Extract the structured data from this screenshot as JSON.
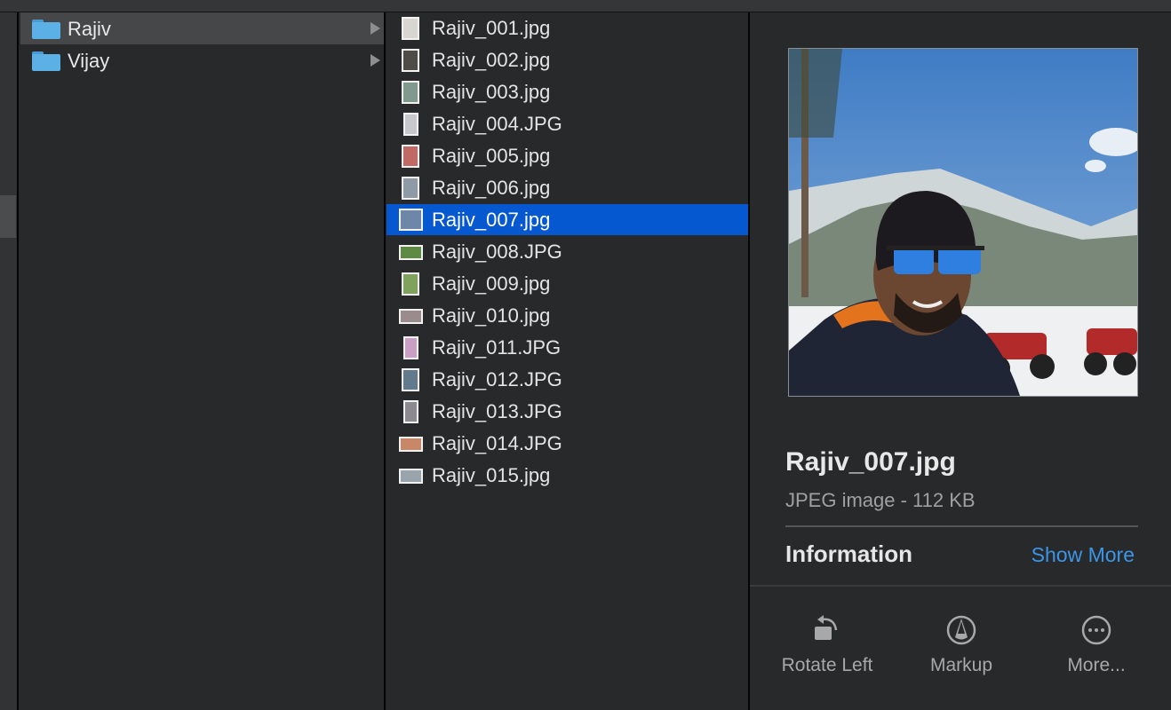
{
  "previous_column": {
    "selected_index": 0
  },
  "folders": [
    {
      "name": "Rajiv",
      "selected": true,
      "has_children": true,
      "icon": "folder-icon"
    },
    {
      "name": "Vijay",
      "selected": false,
      "has_children": true,
      "icon": "folder-icon"
    }
  ],
  "files": [
    {
      "name": "Rajiv_001.jpg",
      "orientation": "portrait",
      "thumb_color": "#d9d6d0",
      "selected": false
    },
    {
      "name": "Rajiv_002.jpg",
      "orientation": "portrait",
      "thumb_color": "#4f4c48",
      "selected": false
    },
    {
      "name": "Rajiv_003.jpg",
      "orientation": "portrait",
      "thumb_color": "#7f9a8c",
      "selected": false
    },
    {
      "name": "Rajiv_004.JPG",
      "orientation": "narrow",
      "thumb_color": "#c8c8cc",
      "selected": false
    },
    {
      "name": "Rajiv_005.jpg",
      "orientation": "portrait",
      "thumb_color": "#c06a66",
      "selected": false
    },
    {
      "name": "Rajiv_006.jpg",
      "orientation": "portrait",
      "thumb_color": "#8e9aa6",
      "selected": false
    },
    {
      "name": "Rajiv_007.jpg",
      "orientation": "landscape-square",
      "thumb_color": "#6e87a8",
      "selected": true
    },
    {
      "name": "Rajiv_008.JPG",
      "orientation": "land",
      "thumb_color": "#5f8a44",
      "selected": false
    },
    {
      "name": "Rajiv_009.jpg",
      "orientation": "portrait",
      "thumb_color": "#7fa25c",
      "selected": false
    },
    {
      "name": "Rajiv_010.jpg",
      "orientation": "land",
      "thumb_color": "#9a8c8c",
      "selected": false
    },
    {
      "name": "Rajiv_011.JPG",
      "orientation": "narrow",
      "thumb_color": "#c9a0c4",
      "selected": false
    },
    {
      "name": "Rajiv_012.JPG",
      "orientation": "portrait",
      "thumb_color": "#627a8c",
      "selected": false
    },
    {
      "name": "Rajiv_013.JPG",
      "orientation": "narrow",
      "thumb_color": "#8c8a90",
      "selected": false
    },
    {
      "name": "Rajiv_014.JPG",
      "orientation": "land",
      "thumb_color": "#c88868",
      "selected": false
    },
    {
      "name": "Rajiv_015.jpg",
      "orientation": "land",
      "thumb_color": "#9aa4ac",
      "selected": false
    }
  ],
  "preview": {
    "image_description": "Selfie of man in black beanie and blue mirrored sunglasses in snowy mountains with red ATVs",
    "file_name": "Rajiv_007.jpg",
    "file_info": "JPEG image - 112 KB",
    "section_title": "Information",
    "show_more_label": "Show More",
    "link_color": "#3d95e8",
    "actions": [
      {
        "label": "Rotate Left",
        "icon": "rotate-left-icon"
      },
      {
        "label": "Markup",
        "icon": "markup-icon"
      },
      {
        "label": "More...",
        "icon": "more-icon"
      }
    ]
  },
  "colors": {
    "selection": "#0658d0",
    "folder_selection": "#464749",
    "folder": "#5bb1e6"
  }
}
